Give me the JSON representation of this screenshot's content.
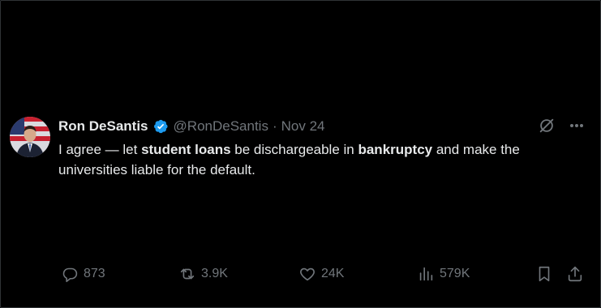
{
  "author": {
    "name": "Ron DeSantis",
    "handle": "@RonDeSantis",
    "separator": "·",
    "date": "Nov 24",
    "verified": true
  },
  "tweet": {
    "segments": [
      {
        "text": "I agree — let ",
        "bold": false
      },
      {
        "text": "student loans",
        "bold": true
      },
      {
        "text": " be dischargeable in ",
        "bold": false
      },
      {
        "text": "bankruptcy",
        "bold": true
      },
      {
        "text": " and make the universities liable for the default.",
        "bold": false
      }
    ]
  },
  "actions": {
    "replies": "873",
    "reposts": "3.9K",
    "likes": "24K",
    "views": "579K"
  },
  "icons": {
    "verified": "verified-badge-icon",
    "grok": "grok-icon",
    "more": "more-icon",
    "reply": "reply-icon",
    "repost": "repost-icon",
    "like": "heart-icon",
    "views": "views-icon",
    "bookmark": "bookmark-icon",
    "share": "share-icon"
  },
  "colors": {
    "background": "#000000",
    "text": "#e7e9ea",
    "secondary": "#71767b",
    "verified": "#1d9bf0"
  }
}
